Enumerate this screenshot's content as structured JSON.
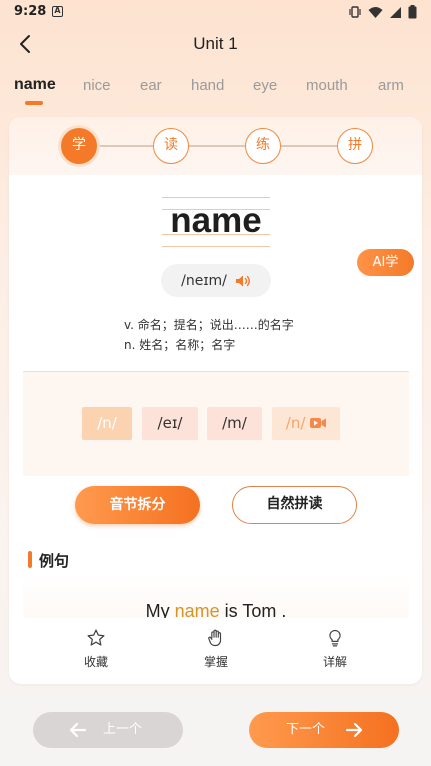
{
  "status": {
    "time": "9:28",
    "notif_glyph": "A"
  },
  "nav": {
    "title": "Unit 1"
  },
  "word_tabs": [
    "name",
    "nice",
    "ear",
    "hand",
    "eye",
    "mouth",
    "arm"
  ],
  "steps": [
    "学",
    "读",
    "练",
    "拼"
  ],
  "word": "name",
  "ai_label": "AI学",
  "phonetic": "/neɪm/",
  "meanings": [
    "v. 命名；提名；说出……的名字",
    "n. 姓名；名称；名字"
  ],
  "syllables": [
    "/n/",
    "/eɪ/",
    "/m/",
    "/n/"
  ],
  "buttons": {
    "split": "音节拆分",
    "phonics": "自然拼读"
  },
  "section": {
    "title": "例句"
  },
  "example": {
    "before": "My ",
    "highlight": "name",
    "after": " is Tom ."
  },
  "actions": {
    "favorite": "收藏",
    "master": "掌握",
    "detail": "详解"
  },
  "bottom": {
    "prev": "上一个",
    "next": "下一个"
  },
  "colors": {
    "accent": "#f47a2a",
    "highlight": "#d89327"
  }
}
